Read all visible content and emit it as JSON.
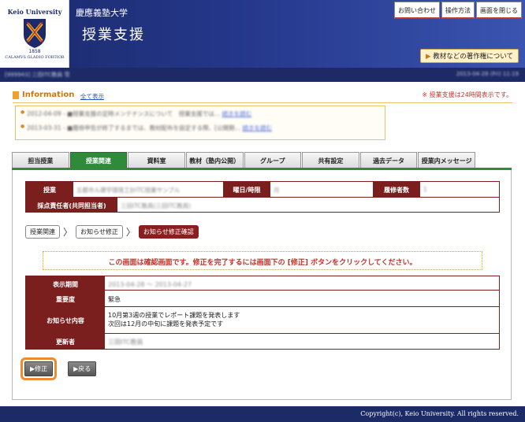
{
  "header": {
    "logo_title": "Keio University",
    "logo_year": "1858",
    "logo_motto": "CALAMVS GLADIO FORTIOR",
    "university": "慶應義塾大学",
    "app_title": "授業支援",
    "buttons": [
      "お問い合わせ",
      "操作方法",
      "画面を閉じる"
    ],
    "copyright_link": "教材などの著作権について"
  },
  "userbar": {
    "user": "[999943] 三田ITC教員 雪",
    "datetime": "2013-04-28 (Fri) 11:19"
  },
  "information": {
    "title": "Information",
    "show_all": "全て表示",
    "note": "※ 授業支援は24時間表示です。",
    "items": [
      {
        "text": "2012-04-09 - ■授業支援の定時メンテナンスについて　授業支援では…",
        "link": "続きを読む"
      },
      {
        "text": "2013-03-31 - ■履修申告が終了するまでは、教材配布を設定する際、[公開期…",
        "link": "続きを読む"
      }
    ]
  },
  "tabs": [
    "担当授業",
    "授業関連",
    "資料室",
    "教材（塾内公開）",
    "グループ",
    "共有設定",
    "過去データ",
    "授業内メッセージ"
  ],
  "active_tab": 1,
  "course": {
    "course_label": "授業",
    "course_value": "五都市ル建学環境工計ITC授業サンプル",
    "day_label": "曜日/時限",
    "day_value": "月",
    "enrolled_label": "履修者数",
    "enrolled_value": "1",
    "grader_label": "採点責任者(共同担当者)",
    "grader_value": "三田ITC教員(三田ITC教員)"
  },
  "breadcrumbs": [
    "授業関連",
    "お知らせ修正",
    "お知らせ修正確認"
  ],
  "confirm_message": "この画面は確認画面です。修正を完了するには画面下の [修正] ボタンをクリックしてください。",
  "notice": {
    "period_label": "表示期間",
    "period_value": "2013-04-28 ～ 2013-04-27",
    "importance_label": "重要度",
    "importance_value": "緊急",
    "content_label": "お知らせ内容",
    "content_lines": [
      "10月第3週の授業でレポート課題を発表します",
      "次回は12月の中旬に課題を発表予定です"
    ],
    "updater_label": "更新者",
    "updater_value": "三田ITC教員"
  },
  "buttons": {
    "submit": "▶修正",
    "back": "▶戻る"
  },
  "footer": "Copyright(c), Keio University. All rights reserved."
}
